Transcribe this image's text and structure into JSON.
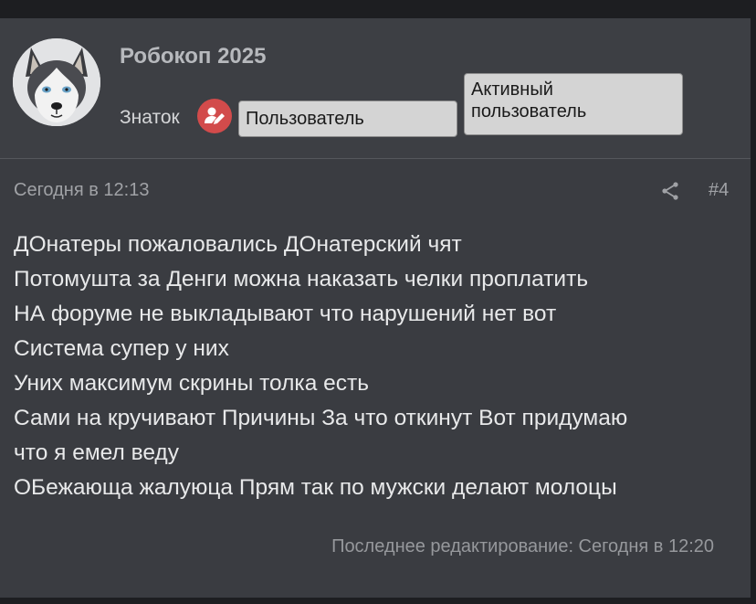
{
  "user": {
    "name": "Робокоп 2025",
    "title": "Знаток",
    "badges": [
      "Пользователь",
      "Активный\nпользователь"
    ]
  },
  "icons": {
    "avatar": "husky-avatar",
    "title_icon": "user-pen-icon",
    "share": "share-icon"
  },
  "colors": {
    "title_icon_bg": "#d24b4b",
    "badge_bg": "#d4d4d4"
  },
  "post": {
    "date": "Сегодня в 12:13",
    "number": "#4",
    "lines": [
      "ДОнатеры пожаловались ДОнатерский чят",
      "Потомушта за Денги можна наказать челки проплатить",
      "НА форуме не выкладывают что нарушений нет вот",
      "Система супер у них",
      "Уних максимум скрины толка есть",
      "Сами на кручивают Причины За что откинут Вот придумаю",
      "что я емел веду",
      "ОБежающа жалуюца Прям так по мужски делают молоцы"
    ],
    "last_edit": "Последнее редактирование: Сегодня в 12:20"
  }
}
